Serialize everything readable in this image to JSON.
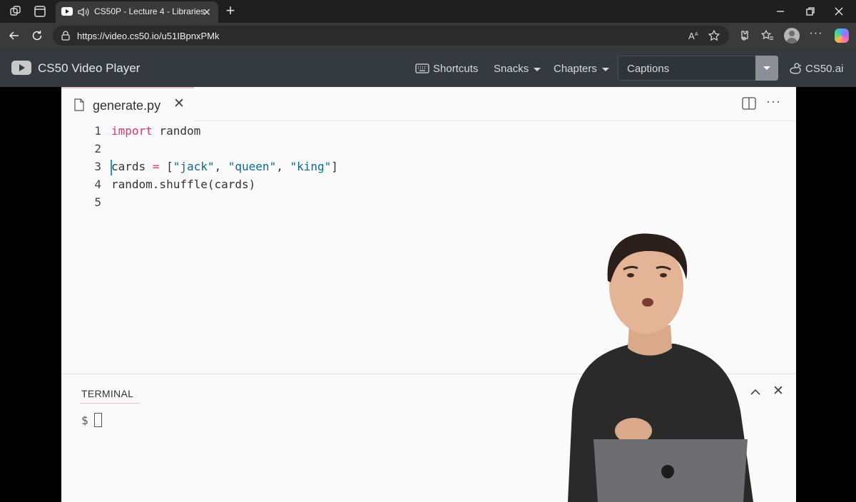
{
  "browser": {
    "tab": {
      "title": "CS50P - Lecture 4 - Libraries",
      "close": "✕"
    },
    "new_tab": "+",
    "url": "https://video.cs50.io/u51IBpnxPMk",
    "more": "···"
  },
  "cs50": {
    "brand": "CS50 Video Player",
    "nav": {
      "shortcuts": "Shortcuts",
      "snacks": "Snacks",
      "chapters": "Chapters"
    },
    "captions": "Captions",
    "ai": "CS50.ai"
  },
  "editor": {
    "filename": "generate.py",
    "close": "✕",
    "more": "···",
    "lines": [
      {
        "n": "1",
        "parts": [
          [
            "kw",
            "import"
          ],
          [
            "t",
            " random"
          ]
        ]
      },
      {
        "n": "2",
        "parts": []
      },
      {
        "n": "3",
        "parts": [
          [
            "t",
            "cards "
          ],
          [
            "op",
            "="
          ],
          [
            "t",
            " ["
          ],
          [
            "str",
            "\"jack\""
          ],
          [
            "t",
            ", "
          ],
          [
            "str",
            "\"queen\""
          ],
          [
            "t",
            ", "
          ],
          [
            "str",
            "\"king\""
          ],
          [
            "t",
            "]"
          ]
        ]
      },
      {
        "n": "4",
        "parts": [
          [
            "t",
            "random.shuffle(cards)"
          ]
        ]
      },
      {
        "n": "5",
        "parts": []
      }
    ]
  },
  "terminal": {
    "title": "TERMINAL",
    "prompt": "$",
    "close": "✕"
  },
  "colors": {
    "keyword": "#d73a6a",
    "string": "#0a6b8f",
    "cursor": "#1a9bc7",
    "header_bg": "#343a40"
  }
}
